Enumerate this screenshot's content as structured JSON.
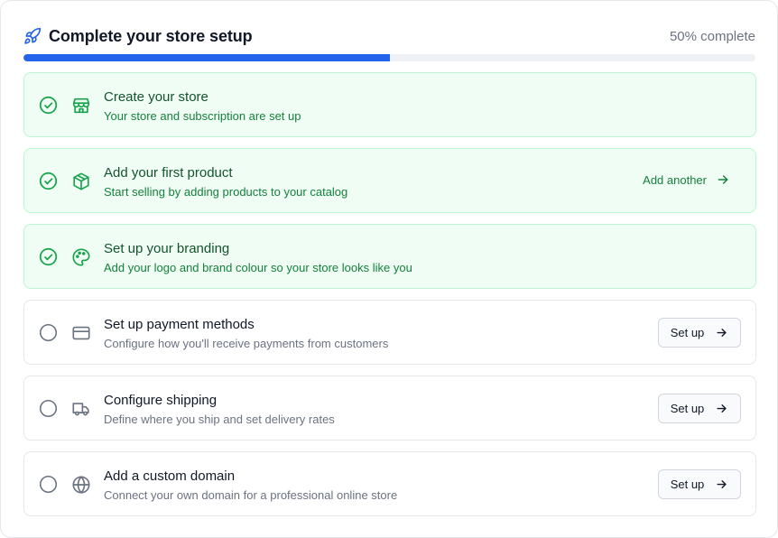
{
  "header": {
    "title": "Complete your store setup",
    "progress_text": "50% complete",
    "progress_value": 0.5,
    "accent_color": "#2563eb"
  },
  "steps": [
    {
      "title": "Create your store",
      "description": "Your store and subscription are set up",
      "status": "completed",
      "icon": "store-icon"
    },
    {
      "title": "Add your first product",
      "description": "Start selling by adding products to your catalog",
      "status": "completed",
      "icon": "package-icon",
      "action_label": "Add another"
    },
    {
      "title": "Set up your branding",
      "description": "Add your logo and brand colour so your store looks like you",
      "status": "completed",
      "icon": "palette-icon"
    },
    {
      "title": "Set up payment methods",
      "description": "Configure how you'll receive payments from customers",
      "status": "pending",
      "icon": "credit-card-icon",
      "action_label": "Set up"
    },
    {
      "title": "Configure shipping",
      "description": "Define where you ship and set delivery rates",
      "status": "pending",
      "icon": "truck-icon",
      "action_label": "Set up"
    },
    {
      "title": "Add a custom domain",
      "description": "Connect your own domain for a professional online store",
      "status": "pending",
      "icon": "globe-icon",
      "action_label": "Set up"
    }
  ],
  "colors": {
    "done_bg": "#f0fdf4",
    "done_border": "#bbf7d0",
    "done_text": "#15803d"
  }
}
